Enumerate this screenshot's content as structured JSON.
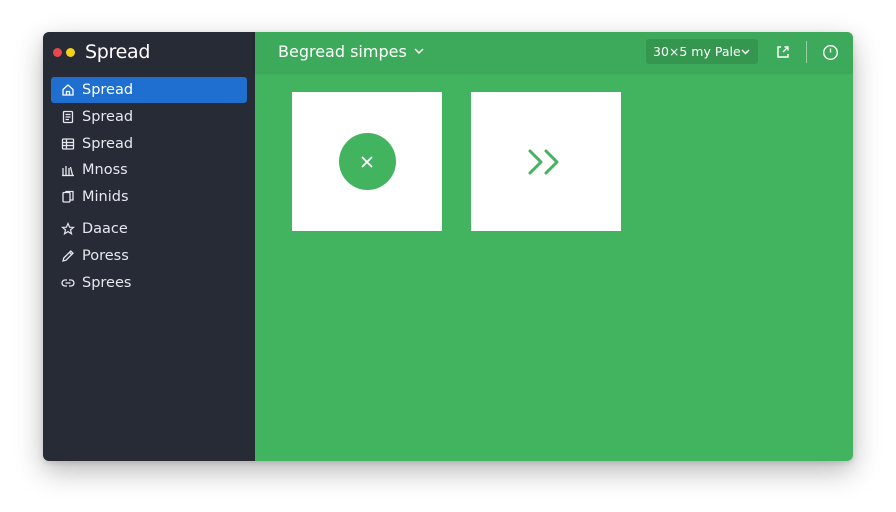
{
  "theme": {
    "sidebar_bg": "#272b35",
    "active_item_bg": "#1e6fd0",
    "accent_green": "#42b35f",
    "topbar_green": "#3da95a",
    "select_bg": "#34964f",
    "dot_red": "#e5484d",
    "dot_yellow": "#f2d21b"
  },
  "app": {
    "title": "Spread"
  },
  "sidebar": {
    "items": [
      {
        "label": "Spread",
        "icon": "home-icon",
        "active": true
      },
      {
        "label": "Spread",
        "icon": "document-icon",
        "active": false
      },
      {
        "label": "Spread",
        "icon": "table-icon",
        "active": false
      },
      {
        "label": "Mnoss",
        "icon": "library-icon",
        "active": false
      },
      {
        "label": "Minids",
        "icon": "files-icon",
        "active": false
      },
      {
        "label": "Daace",
        "icon": "star-icon",
        "active": false
      },
      {
        "label": "Poress",
        "icon": "pencil-icon",
        "active": false
      },
      {
        "label": "Sprees",
        "icon": "link-icon",
        "active": false
      }
    ]
  },
  "topbar": {
    "breadcrumb": "Begread simpes",
    "page_select": "30×5 my Pale",
    "icons": [
      "export-icon",
      "power-icon"
    ]
  },
  "cards": [
    {
      "icon": "close-icon"
    },
    {
      "icon": "forward-icon"
    }
  ]
}
